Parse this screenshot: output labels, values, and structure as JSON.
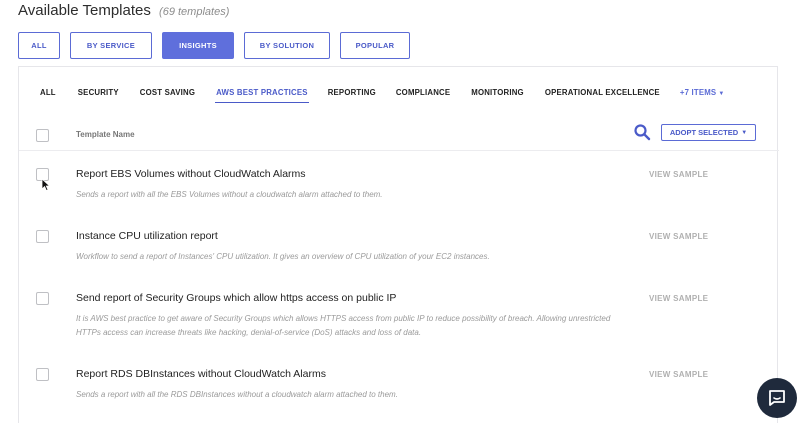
{
  "header": {
    "title": "Available Templates",
    "count": "(69 templates)"
  },
  "filters": [
    {
      "label": "ALL",
      "active": false
    },
    {
      "label": "BY SERVICE",
      "active": false
    },
    {
      "label": "INSIGHTS",
      "active": true
    },
    {
      "label": "BY SOLUTION",
      "active": false
    },
    {
      "label": "POPULAR",
      "active": false
    }
  ],
  "categories": [
    {
      "label": "ALL",
      "active": false
    },
    {
      "label": "SECURITY",
      "active": false
    },
    {
      "label": "COST SAVING",
      "active": false
    },
    {
      "label": "AWS BEST PRACTICES",
      "active": true
    },
    {
      "label": "REPORTING",
      "active": false
    },
    {
      "label": "COMPLIANCE",
      "active": false
    },
    {
      "label": "MONITORING",
      "active": false
    },
    {
      "label": "OPERATIONAL EXCELLENCE",
      "active": false
    }
  ],
  "more_items": "+7 ITEMS",
  "table": {
    "column_name": "Template Name",
    "adopt_label": "ADOPT SELECTED"
  },
  "templates": [
    {
      "title": "Report EBS Volumes without CloudWatch Alarms",
      "description": "Sends a report with all the EBS Volumes without a cloudwatch alarm attached to them.",
      "sample_label": "VIEW SAMPLE"
    },
    {
      "title": "Instance CPU utilization report",
      "description": "Workflow to send a report of Instances' CPU utilization. It gives an overview of CPU utilization of your EC2 instances.",
      "sample_label": "VIEW SAMPLE"
    },
    {
      "title": "Send report of Security Groups which allow https access on public IP",
      "description": "It is AWS best practice to get aware of Security Groups which allows HTTPS access from public IP to reduce possibility of breach. Allowing unrestricted HTTPs access can increase threats like hacking, denial-of-service (DoS) attacks and loss of data.",
      "sample_label": "VIEW SAMPLE"
    },
    {
      "title": "Report RDS DBInstances without CloudWatch Alarms",
      "description": "Sends a report with all the RDS DBInstances without a cloudwatch alarm attached to them.",
      "sample_label": "VIEW SAMPLE"
    }
  ],
  "colors": {
    "accent": "#5f6fdc",
    "chat_button": "#1f2a3c"
  },
  "icons": {
    "search": "search-icon",
    "chat": "chat-icon",
    "cursor": "cursor-icon"
  }
}
